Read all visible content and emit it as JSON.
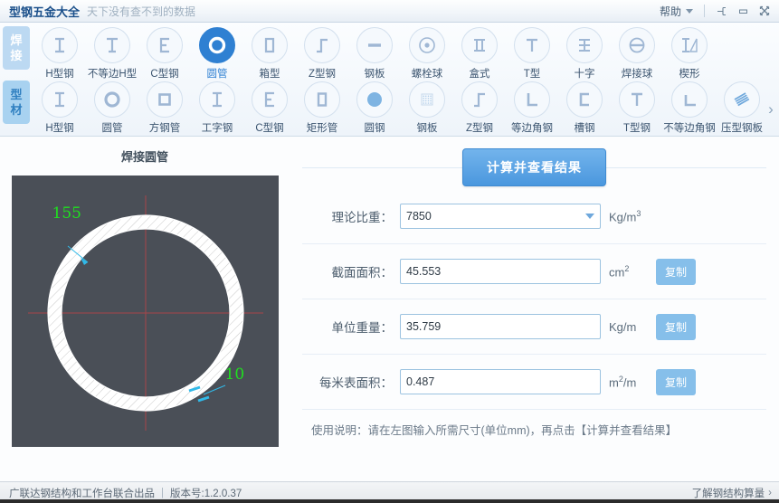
{
  "titlebar": {
    "title": "型钢五金大全",
    "subtitle": "天下没有查不到的数据",
    "help_label": "帮助",
    "pin_icon": "pin-icon",
    "minimize_icon": "minimize-icon",
    "close_icon": "close-icon"
  },
  "toolbar": {
    "rows": [
      {
        "tab_label_line1": "焊",
        "tab_label_line2": "接",
        "selected_index": 3,
        "items": [
          {
            "label": "H型钢",
            "icon": "h-beam-icon"
          },
          {
            "label": "不等边H型",
            "icon": "unequal-h-beam-icon"
          },
          {
            "label": "C型钢",
            "icon": "c-channel-icon"
          },
          {
            "label": "圆管",
            "icon": "round-pipe-icon"
          },
          {
            "label": "箱型",
            "icon": "box-section-icon"
          },
          {
            "label": "Z型钢",
            "icon": "z-section-icon"
          },
          {
            "label": "钢板",
            "icon": "steel-plate-icon"
          },
          {
            "label": "螺栓球",
            "icon": "bolt-ball-icon"
          },
          {
            "label": "盒式",
            "icon": "cassette-icon"
          },
          {
            "label": "T型",
            "icon": "t-section-icon"
          },
          {
            "label": "十字",
            "icon": "cross-section-icon"
          },
          {
            "label": "焊接球",
            "icon": "welded-ball-icon"
          },
          {
            "label": "楔形",
            "icon": "wedge-icon"
          }
        ]
      },
      {
        "tab_label_line1": "型",
        "tab_label_line2": "材",
        "selected_index": -1,
        "items": [
          {
            "label": "H型钢",
            "icon": "h-beam-icon"
          },
          {
            "label": "圆管",
            "icon": "round-pipe-icon"
          },
          {
            "label": "方钢管",
            "icon": "square-tube-icon"
          },
          {
            "label": "工字钢",
            "icon": "i-beam-icon"
          },
          {
            "label": "C型钢",
            "icon": "c-channel-icon"
          },
          {
            "label": "矩形管",
            "icon": "rect-tube-icon"
          },
          {
            "label": "圆钢",
            "icon": "round-bar-icon"
          },
          {
            "label": "钢板",
            "icon": "steel-plate-hatch-icon"
          },
          {
            "label": "Z型钢",
            "icon": "z-section-icon"
          },
          {
            "label": "等边角钢",
            "icon": "equal-angle-icon"
          },
          {
            "label": "槽钢",
            "icon": "channel-icon"
          },
          {
            "label": "T型钢",
            "icon": "t-steel-icon"
          },
          {
            "label": "不等边角钢",
            "icon": "unequal-angle-icon"
          },
          {
            "label": "压型钢板",
            "icon": "profiled-plate-icon"
          }
        ],
        "scroll_next_icon": "chevron-right-icon"
      }
    ]
  },
  "diagram": {
    "title": "焊接圆管",
    "outer_diameter_label": "155",
    "wall_thickness_label": "10",
    "label_color": "#1fe01f",
    "canvas_bg": "#4a4f57"
  },
  "form": {
    "calculate_button": "计算并查看结果",
    "fields": [
      {
        "label": "理论比重：",
        "value": "7850",
        "unit": "Kg/m",
        "unit_sup": "3",
        "type": "select",
        "copy_label": ""
      },
      {
        "label": "截面面积：",
        "value": "45.553",
        "unit": "cm",
        "unit_sup": "2",
        "type": "text",
        "copy_label": "复制"
      },
      {
        "label": "单位重量：",
        "value": "35.759",
        "unit": "Kg/m",
        "unit_sup": "",
        "type": "text",
        "copy_label": "复制"
      },
      {
        "label": "每米表面积：",
        "value": "0.487",
        "unit_pre": "m",
        "unit_sup": "2",
        "unit_post": "/m",
        "unit": "",
        "type": "text",
        "copy_label": "复制"
      }
    ],
    "hint": "使用说明：请在左图输入所需尺寸(单位mm)，再点击【计算并查看结果】"
  },
  "footer": {
    "producer": "广联达钢结构和工作台联合出品",
    "separator": "|",
    "version": "版本号:1.2.0.37",
    "link": "了解钢结构算量",
    "chevron": "›"
  }
}
